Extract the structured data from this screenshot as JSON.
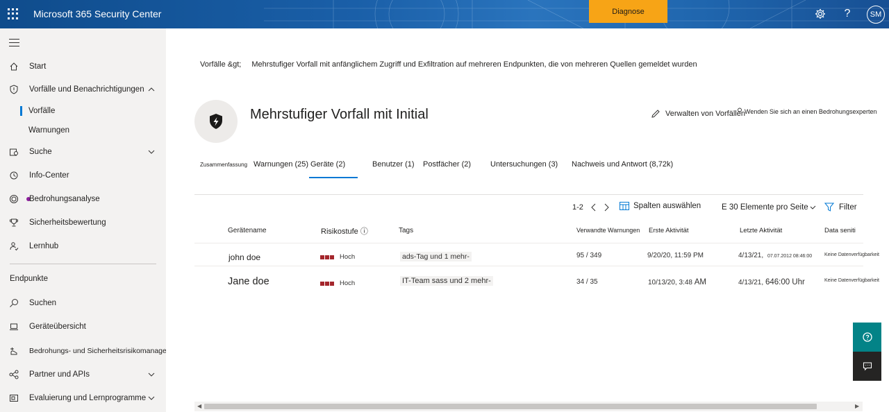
{
  "topbar": {
    "app_title": "Microsoft 365 Security Center",
    "diagnose_label": "Diagnose",
    "avatar_initials": "SM",
    "icons": [
      "waffle-icon",
      "settings-icon",
      "help-icon"
    ]
  },
  "sidebar": {
    "items": [
      {
        "label": "Start",
        "icon": "home-icon"
      },
      {
        "label": "Vorfälle und Benachrichtigungen",
        "icon": "shield-icon"
      },
      {
        "label": "Vorfälle"
      },
      {
        "label": "Warnungen"
      },
      {
        "label": "Suche",
        "icon": "hunting-icon"
      },
      {
        "label": "Info-Center",
        "icon": "action-center-icon"
      },
      {
        "label": "Bedrohungsanalyse",
        "icon": "threat-analytics-icon"
      },
      {
        "label": "Sicherheitsbewertung",
        "icon": "trophy-icon"
      },
      {
        "label": "Lernhub",
        "icon": "learning-icon"
      }
    ],
    "section_endpoints": "Endpunkte",
    "endpoint_items": [
      {
        "label": "Suchen",
        "icon": "search-icon"
      },
      {
        "label": "Geräteübersicht",
        "icon": "laptop-icon"
      },
      {
        "label": "Bedrohungs- und Sicherheitsrisikomanagement",
        "icon": "tvm-icon"
      },
      {
        "label": "Partner und APIs",
        "icon": "partners-icon"
      },
      {
        "label": "Evaluierung und Lernprogramme",
        "icon": "evaluation-icon"
      }
    ]
  },
  "breadcrumb": {
    "root": "Vorfälle &gt;",
    "current": "Mehrstufiger Vorfall mit anfänglichem Zugriff und Exfiltration auf mehreren Endpunkten, die von mehreren Quellen gemeldet wurden"
  },
  "header": {
    "title": "Mehrstufiger Vorfall mit Initial",
    "manage_label": "Verwalten von Vorfällen",
    "expert_label": "Wenden Sie sich an einen Bedrohungsexperten"
  },
  "tabs": [
    {
      "label": "Zusammenfassung"
    },
    {
      "label": "Warnungen (25)"
    },
    {
      "label": "Geräte (2)"
    },
    {
      "label": "Benutzer (1)"
    },
    {
      "label": "Postfächer (2)"
    },
    {
      "label": "Untersuchungen (3)"
    },
    {
      "label": "Nachweis und Antwort (8,72k)"
    }
  ],
  "toolbar": {
    "range": "1-2",
    "columns_label": "Spalten auswählen",
    "page_size_label": "E 30 Elemente pro Seite",
    "filter_label": "Filter"
  },
  "table": {
    "headers": [
      "Gerätename",
      "Risikostufe ⓘ",
      "Tags",
      "Verwandte Warnungen",
      "Erste Aktivität",
      "Letzte Aktivität",
      "Data seniti"
    ],
    "rows": [
      {
        "name": "john doe",
        "risk": "Hoch",
        "tags": "ads-Tag und 1 mehr-",
        "alerts": "95 / 349",
        "first": "9/20/20, 11:59 PM",
        "last_date": "4/13/21,",
        "last_extra": "07.07.2012  08:46:00",
        "data": "Keine Datenverfügbarkeit"
      },
      {
        "name": "Jane doe",
        "risk": "Hoch",
        "tags": "IT-Team sass und 2 mehr-",
        "alerts": "34 / 35",
        "first_date": "10/13/20, 3:48",
        "first_ampm": "AM",
        "last_date": "4/13/21,",
        "last_extra": "646:00 Uhr",
        "data": "Keine Datenverfügbarkeit"
      }
    ]
  },
  "colors": {
    "accent": "#0078d4",
    "diagnose": "#f7a416",
    "risk_high": "#a4262c",
    "help_button": "#038387",
    "chat_button": "#252423"
  }
}
